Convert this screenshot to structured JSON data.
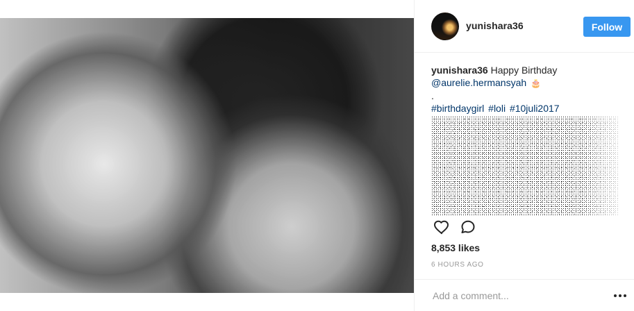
{
  "post": {
    "username": "yunishara36",
    "follow_label": "Follow",
    "caption": {
      "text": "Happy Birthday",
      "mention": "@aurelie.hermansyah",
      "emoji": "🎂",
      "dot": ".",
      "hashtags": [
        "#birthdaygirl",
        "#loli",
        "#10juli2017"
      ]
    },
    "likes_text": "8,853 likes",
    "timestamp": "6 HOURS AGO",
    "comment_placeholder": "Add a comment..."
  },
  "colors": {
    "follow_button": "#3897f0",
    "link": "#003569",
    "text": "#262626",
    "muted": "#999999",
    "border": "#efefef"
  },
  "icons": {
    "like": "heart-outline-icon",
    "comment": "speech-bubble-outline-icon",
    "more": "three-dots-icon"
  }
}
